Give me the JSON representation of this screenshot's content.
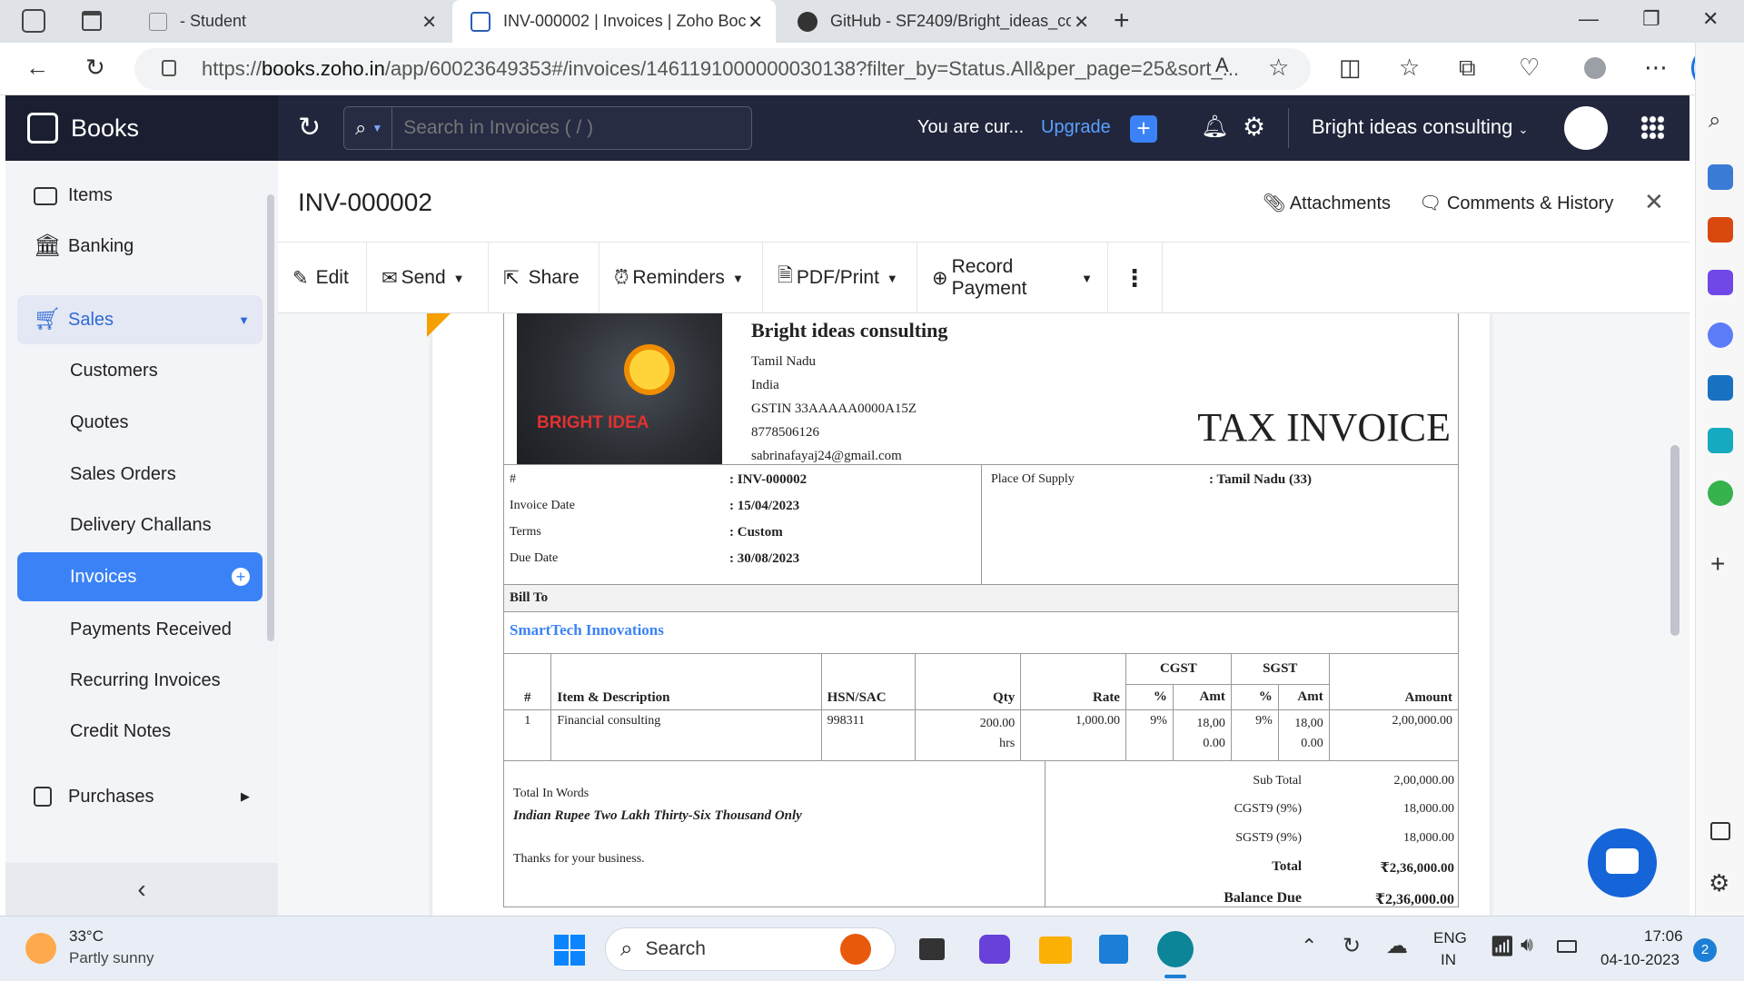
{
  "browser": {
    "tabs": [
      {
        "label": "- Student"
      },
      {
        "label": "INV-000002 | Invoices | Zoho Boc"
      },
      {
        "label": "GitHub - SF2409/Bright_ideas_co"
      }
    ],
    "url_prefix": "https://",
    "url_host": "books.zoho.in",
    "url_rest": "/app/60023649353#/invoices/1461191000000030138?filter_by=Status.All&per_page=25&sort_..."
  },
  "app": {
    "brand": "Books",
    "search_placeholder": "Search in Invoices ( / )",
    "trial_text": "You are cur...",
    "upgrade": "Upgrade",
    "org_name": "Bright ideas consulting"
  },
  "sidebar": {
    "items": [
      {
        "label": "Items"
      },
      {
        "label": "Banking"
      },
      {
        "label": "Sales"
      },
      {
        "label": "Customers"
      },
      {
        "label": "Quotes"
      },
      {
        "label": "Sales Orders"
      },
      {
        "label": "Delivery Challans"
      },
      {
        "label": "Invoices"
      },
      {
        "label": "Payments Received"
      },
      {
        "label": "Recurring Invoices"
      },
      {
        "label": "Credit Notes"
      },
      {
        "label": "Purchases"
      }
    ]
  },
  "page": {
    "title": "INV-000002",
    "attachments": "Attachments",
    "comments": "Comments & History"
  },
  "toolbar": {
    "edit": "Edit",
    "send": "Send",
    "share": "Share",
    "reminders": "Reminders",
    "pdf": "PDF/Print",
    "record_payment": "Record Payment"
  },
  "invoice": {
    "logo_text": "BRIGHT IDEA",
    "company": "Bright ideas consulting",
    "address": [
      "Tamil Nadu",
      "India",
      "GSTIN 33AAAAA0000A15Z",
      "8778506126",
      "sabrinafayaj24@gmail.com"
    ],
    "doc_title": "TAX INVOICE",
    "meta": [
      {
        "label": "#",
        "value": ": INV-000002"
      },
      {
        "label": "Invoice Date",
        "value": ": 15/04/2023"
      },
      {
        "label": "Terms",
        "value": ": Custom"
      },
      {
        "label": "Due Date",
        "value": ": 30/08/2023"
      }
    ],
    "place_label": "Place Of Supply",
    "place_value": ": Tamil Nadu (33)",
    "bill_to_label": "Bill To",
    "customer": "SmartTech Innovations",
    "table_headers": {
      "num": "#",
      "item": "Item & Description",
      "hsn": "HSN/SAC",
      "qty": "Qty",
      "rate": "Rate",
      "cgst": "CGST",
      "sgst": "SGST",
      "pct": "%",
      "amt": "Amt",
      "amount": "Amount"
    },
    "line": {
      "num": "1",
      "item": "Financial consulting",
      "hsn": "998311",
      "qty": "200.00",
      "qty_unit": "hrs",
      "rate": "1,000.00",
      "cgst_pct": "9%",
      "cgst_amt_1": "18,00",
      "cgst_amt_2": "0.00",
      "sgst_pct": "9%",
      "sgst_amt_1": "18,00",
      "sgst_amt_2": "0.00",
      "amount": "2,00,000.00"
    },
    "words_label": "Total In Words",
    "words": "Indian Rupee Two Lakh Thirty-Six Thousand Only",
    "thanks": "Thanks for your business.",
    "totals": [
      {
        "label": "Sub Total",
        "value": "2,00,000.00"
      },
      {
        "label": "CGST9 (9%)",
        "value": "18,000.00"
      },
      {
        "label": "SGST9 (9%)",
        "value": "18,000.00"
      },
      {
        "label": "Total",
        "value": "₹2,36,000.00"
      },
      {
        "label": "Balance Due",
        "value": "₹2,36,000.00"
      }
    ]
  },
  "taskbar": {
    "temp": "33°C",
    "weather": "Partly sunny",
    "search": "Search",
    "lang1": "ENG",
    "lang2": "IN",
    "time": "17:06",
    "date": "04-10-2023",
    "badge": "2"
  }
}
